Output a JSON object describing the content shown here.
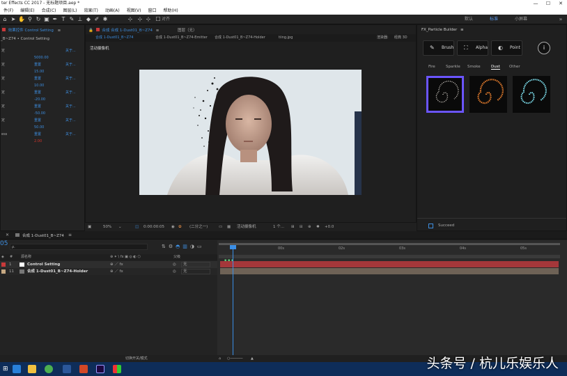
{
  "window": {
    "title": "ter Effects CC 2017 - 无标题项目.aep *"
  },
  "menu": [
    "件(F)",
    "编辑(E)",
    "合成(C)",
    "图层(L)",
    "效果(T)",
    "动画(A)",
    "视图(V)",
    "窗口",
    "帮助(H)"
  ],
  "toolbar": {
    "align_label": "对齐"
  },
  "workspaces": [
    {
      "label": "默认",
      "active": false
    },
    {
      "label": "标准",
      "active": true
    },
    {
      "label": "小屏幕",
      "active": false
    }
  ],
  "effects_panel": {
    "header": "效果控件 Control Setting",
    "subheader": "_B~Z74 • Control Setting",
    "rows": [
      {
        "label": "定",
        "value": "",
        "link": "关于..."
      },
      {
        "label": "",
        "value": "5000.00",
        "link": ""
      },
      {
        "label": "定",
        "value": "重置",
        "link": "关于..."
      },
      {
        "label": "",
        "value": "15.00",
        "link": ""
      },
      {
        "label": "定",
        "value": "重置",
        "link": "关于..."
      },
      {
        "label": "",
        "value": "10.00",
        "link": ""
      },
      {
        "label": "定",
        "value": "重置",
        "link": "关于..."
      },
      {
        "label": "",
        "value": "-20.00",
        "link": ""
      },
      {
        "label": "定",
        "value": "重置",
        "link": "关于..."
      },
      {
        "label": "",
        "value": "-50.00",
        "link": ""
      },
      {
        "label": "定",
        "value": "重置",
        "link": "关于..."
      },
      {
        "label": "",
        "value": "50.00",
        "link": ""
      },
      {
        "label": "ess",
        "value": "重置",
        "link": "关于..."
      },
      {
        "label": "",
        "value": "2.00",
        "link": ""
      }
    ]
  },
  "composition": {
    "tab_label": "合成 合成 1-Dust01_B~Z74",
    "layer_tab": "图层（无）",
    "breadcrumbs": [
      "合成 1-Dust01_B~Z74",
      "合成 1-Dust01_B~Z74-Emitter",
      "合成 1-Dust01_B~Z74-Holder",
      "tiing.jpg"
    ],
    "renderer_label": "渲染器:",
    "renderer_value": "经典 3D",
    "camera_label": "活动摄像机",
    "footer": {
      "zoom": "50%",
      "timecode": "0:00:00:05",
      "resolution": "(二分之一)",
      "camera": "活动摄像机",
      "views": "1 个...",
      "exposure": "+0.0"
    }
  },
  "builder": {
    "title": "FX_Particle Builder",
    "buttons": [
      "Brush",
      "Alpha",
      "Point"
    ],
    "info_label": "i",
    "tabs": [
      {
        "label": "Fire",
        "active": false
      },
      {
        "label": "Sparkle",
        "active": false
      },
      {
        "label": "Smoke",
        "active": false
      },
      {
        "label": "Dust",
        "active": true
      },
      {
        "label": "Other",
        "active": false
      }
    ],
    "status": "Succeed"
  },
  "timeline": {
    "comp_tab": "合成 1-Dust01_B~Z74",
    "current_time": "05",
    "search_placeholder": "ρ.",
    "col_source": "源名称",
    "col_parent": "父级",
    "layers": [
      {
        "index": "1",
        "name": "Control Setting",
        "parent": "无",
        "color": "#c8393a"
      },
      {
        "index": "11",
        "name": "合成 1-Dust01_B~Z74-Holder",
        "parent": "无",
        "color": "#c6a882"
      }
    ],
    "ruler": [
      "00s",
      "02s",
      "03s",
      "04s",
      "05s"
    ],
    "footer_label": "切换开关/模式"
  },
  "watermark": "头条号 / 杭儿乐娱乐人"
}
